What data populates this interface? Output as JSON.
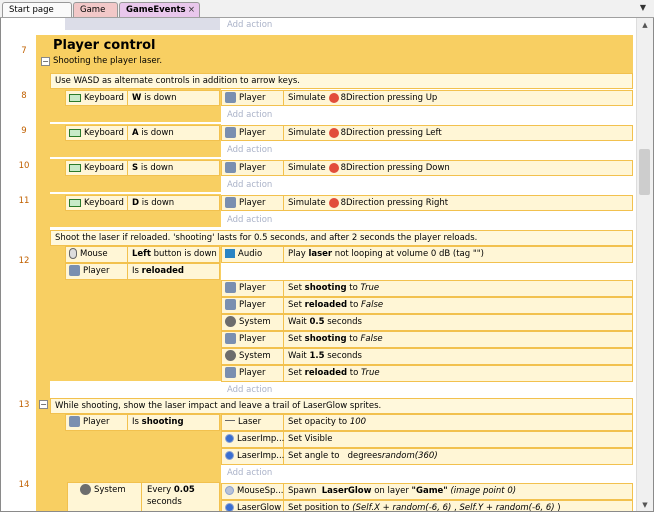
{
  "tabs": [
    {
      "label": "Start page"
    },
    {
      "label": "Game"
    },
    {
      "label": "GameEvents"
    }
  ],
  "tab_close": "×",
  "tab_menu": "▼",
  "add_action": "Add action",
  "group": {
    "line": "7",
    "title": "Player control",
    "description": "Shooting the player laser."
  },
  "comments": [
    "Use WASD as alternate controls in addition to arrow keys.",
    "Shoot the laser if reloaded.  'shooting' lasts for 0.5 seconds, and after 2 seconds the player reloads.",
    "While shooting, show the laser impact and leave a trail of LaserGlow sprites."
  ],
  "key_events": [
    {
      "line": "8",
      "cond_object": "Keyboard",
      "key": "W",
      "cond_text": "is down",
      "act_object": "Player",
      "act_pre": "Simulate",
      "behavior": "8Direction pressing Up"
    },
    {
      "line": "9",
      "cond_object": "Keyboard",
      "key": "A",
      "cond_text": "is down",
      "act_object": "Player",
      "act_pre": "Simulate",
      "behavior": "8Direction pressing Left"
    },
    {
      "line": "10",
      "cond_object": "Keyboard",
      "key": "S",
      "cond_text": "is down",
      "act_object": "Player",
      "act_pre": "Simulate",
      "behavior": "8Direction pressing Down"
    },
    {
      "line": "11",
      "cond_object": "Keyboard",
      "key": "D",
      "cond_text": "is down",
      "act_object": "Player",
      "act_pre": "Simulate",
      "behavior": "8Direction pressing Right"
    }
  ],
  "event12": {
    "line": "12",
    "conditions": [
      {
        "object": "Mouse",
        "bold": "Left",
        "text": " button is down"
      },
      {
        "object": "Player",
        "pre": "Is ",
        "bold": "reloaded"
      }
    ],
    "actions": [
      {
        "object": "Audio",
        "t1": "Play ",
        "b1": "laser",
        "t2": " not looping at volume 0 dB (tag \"\")"
      },
      {
        "object": "Player",
        "t1": "Set ",
        "b1": "shooting",
        "t2": " to ",
        "i1": "True"
      },
      {
        "object": "Player",
        "t1": "Set ",
        "b1": "reloaded",
        "t2": " to ",
        "i1": "False"
      },
      {
        "object": "System",
        "t1": "Wait ",
        "b1": "0.5",
        "t2": " seconds"
      },
      {
        "object": "Player",
        "t1": "Set ",
        "b1": "shooting",
        "t2": " to ",
        "i1": "False"
      },
      {
        "object": "System",
        "t1": "Wait ",
        "b1": "1.5",
        "t2": " seconds"
      },
      {
        "object": "Player",
        "t1": "Set ",
        "b1": "reloaded",
        "t2": " to ",
        "i1": "True"
      }
    ]
  },
  "event13": {
    "line": "13",
    "condition": {
      "object": "Player",
      "pre": "Is ",
      "bold": "shooting"
    },
    "actions": [
      {
        "object": "Laser",
        "t1": "Set opacity to ",
        "i1": "100"
      },
      {
        "object": "LaserImp...",
        "t1": "Set Visible"
      },
      {
        "object": "LaserImp...",
        "t1": "Set angle to ",
        "i1": "random(360)",
        "t2": "  degrees"
      }
    ]
  },
  "event14": {
    "line": "14",
    "condition": {
      "object": "System",
      "pre": "Every ",
      "bold": "0.05",
      "post": "seconds"
    },
    "actions": [
      {
        "object": "MouseSp...",
        "t1": "Spawn  ",
        "b1": "LaserGlow",
        "t2": " on layer ",
        "b2": "\"Game\"",
        "i1": " (image point 0)"
      },
      {
        "object": "LaserGlow",
        "t1": "Set position to ",
        "i1": "(Self.X + random(-6, 6)",
        "t2": " , ",
        "i2": "Self.Y + random(-6, 6)",
        "t3": " )"
      }
    ]
  }
}
